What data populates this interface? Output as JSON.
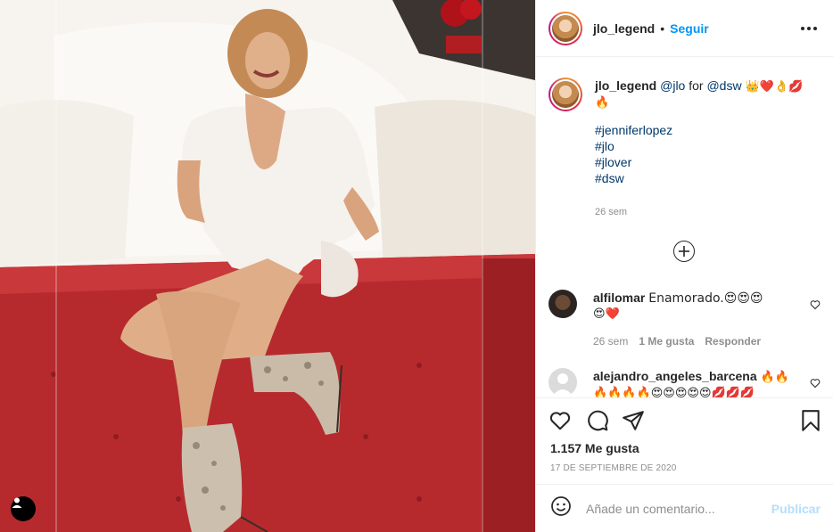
{
  "post": {
    "author": "jlo_legend",
    "separator": "•",
    "follow_label": "Seguir",
    "more_icon": "more-horizontal-icon"
  },
  "caption": {
    "user": "jlo_legend",
    "mention1": "@jlo",
    "text_for": " for ",
    "mention2": "@dsw",
    "emojis": " 👑❤️👌💋",
    "emoji_line2": "🔥",
    "hashtags": [
      "#jenniferlopez",
      "#jlo",
      "#jlover",
      "#dsw"
    ],
    "time": "26 sem"
  },
  "load_more_icon": "plus-circle-icon",
  "comments": [
    {
      "user": "alfilomar",
      "text": "Enamorado.😍😍😍",
      "text2": "😍❤️",
      "time": "26 sem",
      "likes": "1 Me gusta",
      "reply": "Responder"
    },
    {
      "user": "alejandro_angeles_barcena",
      "text": "🔥🔥",
      "text2": "🔥🔥🔥🔥😍😍😍😍😍💋💋💋"
    }
  ],
  "actions": {
    "like_icon": "heart-icon",
    "comment_icon": "comment-icon",
    "share_icon": "paper-plane-icon",
    "save_icon": "bookmark-icon"
  },
  "likes_count": "1.157 Me gusta",
  "date": "17 DE SEPTIEMBRE DE 2020",
  "composer": {
    "emoji_icon": "smiley-icon",
    "placeholder": "Añade un comentario...",
    "publish_label": "Publicar"
  },
  "colors": {
    "link_blue": "#0095f6",
    "publish_disabled": "#b2dffc",
    "hashtag": "#00376b",
    "muted": "#8e8e8e"
  }
}
